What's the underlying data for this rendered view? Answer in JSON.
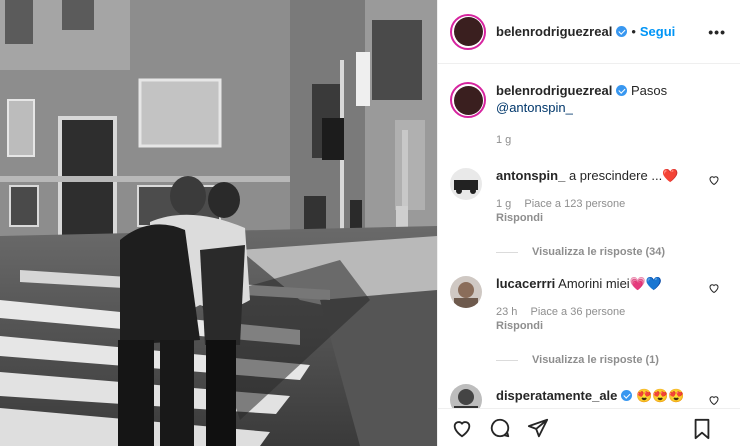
{
  "post": {
    "author": "belenrodriguezreal",
    "follow_label": "Segui",
    "more_label": "•••",
    "caption_text": "Pasos",
    "caption_mention": "@antonspin_",
    "time": "1 g"
  },
  "comments": [
    {
      "user": "antonspin_",
      "text": "a prescindere ...",
      "emoji": "❤️",
      "time": "1 g",
      "likes": "Piace a 123 persone",
      "reply_label": "Rispondi",
      "view_replies": "Visualizza le risposte (34)"
    },
    {
      "user": "lucacerrri",
      "text": "Amorini miei",
      "emoji": "💗💙",
      "time": "23 h",
      "likes": "Piace a 36 persone",
      "reply_label": "Rispondi",
      "view_replies": "Visualizza le risposte (1)"
    },
    {
      "user": "disperatamente_ale",
      "text": "",
      "emoji": "😍😍😍"
    }
  ],
  "icons": [
    "heart-icon",
    "comment-icon",
    "share-icon",
    "bookmark-icon",
    "verified-icon",
    "more-icon"
  ],
  "colors": {
    "link": "#0095f6",
    "verified": "#3897f0",
    "muted": "#8e8e8e"
  }
}
